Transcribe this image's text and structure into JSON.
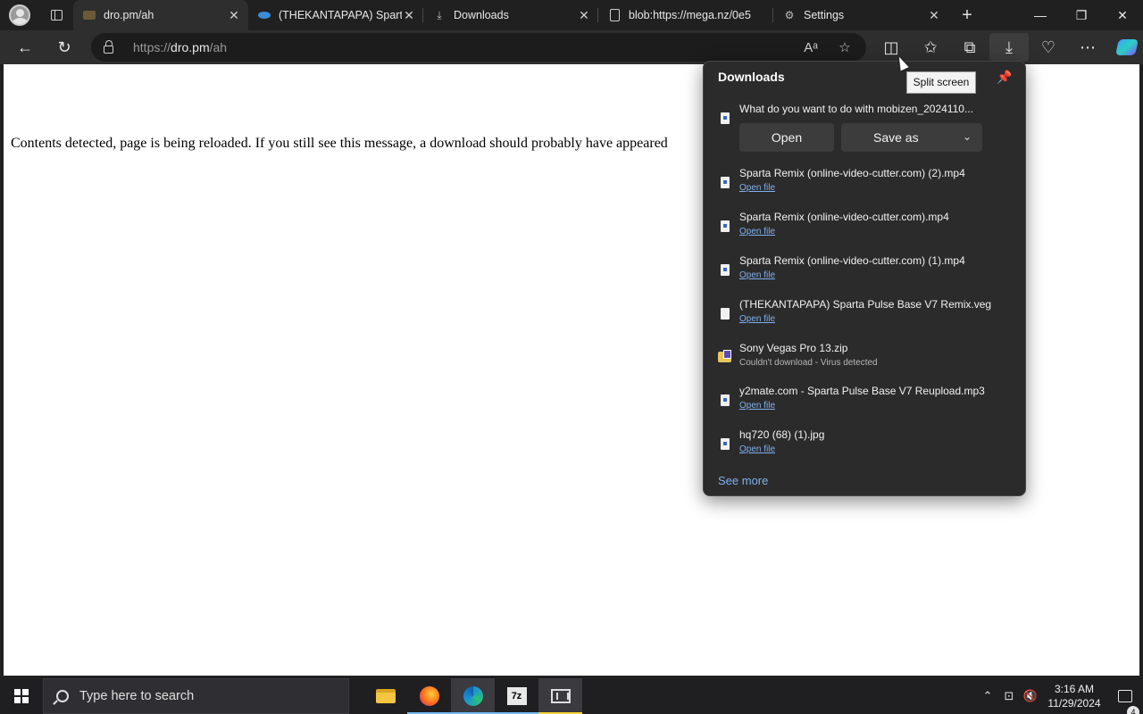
{
  "tabs": [
    {
      "title": "dro.pm/ah",
      "active": true,
      "favicon": "folder-favicon"
    },
    {
      "title": "(THEKANTAPAPA) Sparta",
      "active": false,
      "favicon": "sparta-favicon"
    },
    {
      "title": "Downloads",
      "active": false,
      "favicon": "download-icon"
    },
    {
      "title": "blob:https://mega.nz/0e5",
      "active": false,
      "favicon": "page-icon"
    },
    {
      "title": "Settings",
      "active": false,
      "favicon": "gear-icon"
    }
  ],
  "window_controls": {
    "minimize": "—",
    "restore": "❐",
    "close": "✕"
  },
  "address_bar": {
    "scheme": "https://",
    "host": "dro.pm",
    "path": "/ah"
  },
  "page": {
    "message": "Contents detected, page is being reloaded. If you still see this message, a download should probably have appeared"
  },
  "downloads": {
    "title": "Downloads",
    "tooltip": "Split screen",
    "prompt": {
      "name": "What do you want to do with mobizen_2024110...",
      "open_label": "Open",
      "save_as_label": "Save as"
    },
    "items": [
      {
        "name": "Sparta Remix (online-video-cutter.com) (2).mp4",
        "action": "Open file",
        "icon": "video-file-icon"
      },
      {
        "name": "Sparta Remix (online-video-cutter.com).mp4",
        "action": "Open file",
        "icon": "video-file-icon"
      },
      {
        "name": "Sparta Remix (online-video-cutter.com) (1).mp4",
        "action": "Open file",
        "icon": "video-file-icon"
      },
      {
        "name": "(THEKANTAPAPA) Sparta Pulse Base V7 Remix.veg",
        "action": "Open file",
        "icon": "blank-file-icon"
      },
      {
        "name": "Sony Vegas Pro 13.zip",
        "status": "Couldn't download - Virus detected",
        "icon": "zip-folder-icon"
      },
      {
        "name": "y2mate.com - Sparta Pulse Base V7 Reupload.mp3",
        "action": "Open file",
        "icon": "audio-file-icon"
      },
      {
        "name": "hq720 (68) (1).jpg",
        "action": "Open file",
        "icon": "image-file-icon"
      }
    ],
    "see_more": "See more"
  },
  "taskbar": {
    "search_placeholder": "Type here to search",
    "apps": [
      "file-explorer",
      "firefox",
      "edge",
      "7-zip",
      "vegas"
    ],
    "time": "3:16 AM",
    "date": "11/29/2024",
    "notification_count": "4"
  },
  "colors": {
    "accent_link": "#7fb0ef",
    "flyout_bg": "#2b2b2b",
    "tab_active": "#2e2e2e"
  }
}
